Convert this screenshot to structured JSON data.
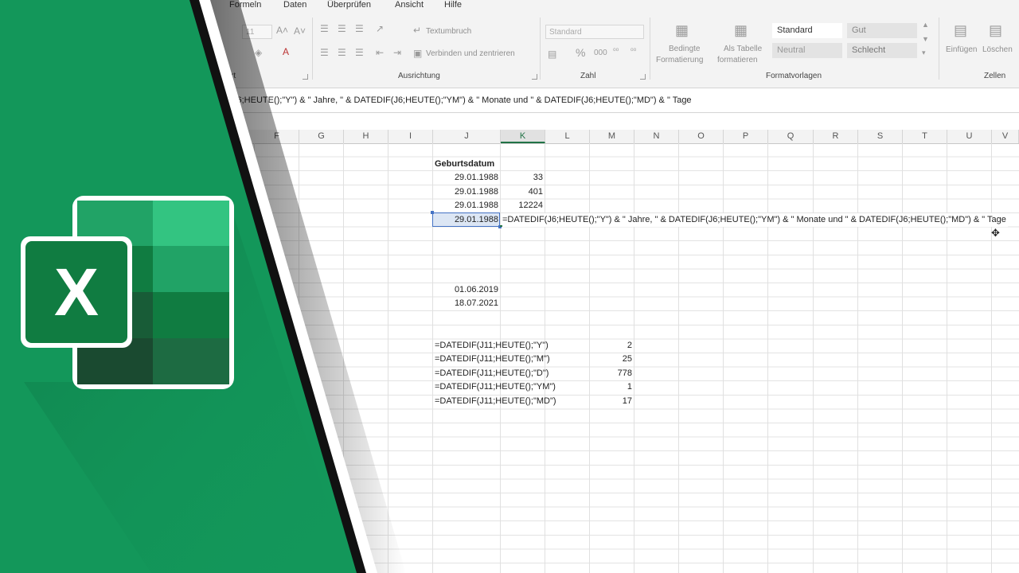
{
  "ribbon": {
    "tabs": [
      "Formeln",
      "Daten",
      "Überprüfen",
      "Ansicht",
      "Hilfe"
    ],
    "font_size": "11",
    "wrap_text": "Textumbruch",
    "merge_center": "Verbinden und zentrieren",
    "number_format": "Standard",
    "conditional_formatting": [
      "Bedingte",
      "Formatierung"
    ],
    "as_table": [
      "Als Tabelle",
      "formatieren"
    ],
    "styles": [
      "Standard",
      "Gut",
      "Neutral",
      "Schlecht"
    ],
    "insert": "Einfügen",
    "delete": "Löschen",
    "groups": {
      "schrift_partial": "rt",
      "alignment": "Ausrichtung",
      "number": "Zahl",
      "styles": "Formatvorlagen",
      "cells": "Zellen"
    }
  },
  "formula_bar": {
    "text": "J6;HEUTE();\"Y\") & \" Jahre, \" & DATEDIF(J6;HEUTE();\"YM\") & \" Monate und \" & DATEDIF(J6;HEUTE();\"MD\") & \" Tage"
  },
  "columns": [
    "F",
    "G",
    "H",
    "I",
    "J",
    "K",
    "L",
    "M",
    "N",
    "O",
    "P",
    "Q",
    "R",
    "S",
    "T",
    "U",
    "V"
  ],
  "cells": {
    "header": "Geburtsdatum",
    "rows": [
      {
        "date": "29.01.1988",
        "value": "33"
      },
      {
        "date": "29.01.1988",
        "value": "401"
      },
      {
        "date": "29.01.1988",
        "value": "12224"
      },
      {
        "date": "29.01.1988",
        "value": "=DATEDIF(J6;HEUTE();\"Y\") & \" Jahre, \" & DATEDIF(J6;HEUTE();\"YM\") & \" Monate und \" & DATEDIF(J6;HEUTE();\"MD\") & \" Tage"
      }
    ],
    "date2": "01.06.2019",
    "date3": "18.07.2021",
    "formulas": [
      {
        "formula": "=DATEDIF(J11;HEUTE();\"Y\")",
        "result": "2"
      },
      {
        "formula": "=DATEDIF(J11;HEUTE();\"M\")",
        "result": "25"
      },
      {
        "formula": "=DATEDIF(J11;HEUTE();\"D\")",
        "result": "778"
      },
      {
        "formula": "=DATEDIF(J11;HEUTE();\"YM\")",
        "result": "1"
      },
      {
        "formula": "=DATEDIF(J11;HEUTE();\"MD\")",
        "result": "17"
      }
    ]
  },
  "logo": {
    "letter": "X"
  },
  "colors": {
    "excel_green": "#13975a",
    "excel_dark": "#185c37",
    "selection": "#217346"
  }
}
